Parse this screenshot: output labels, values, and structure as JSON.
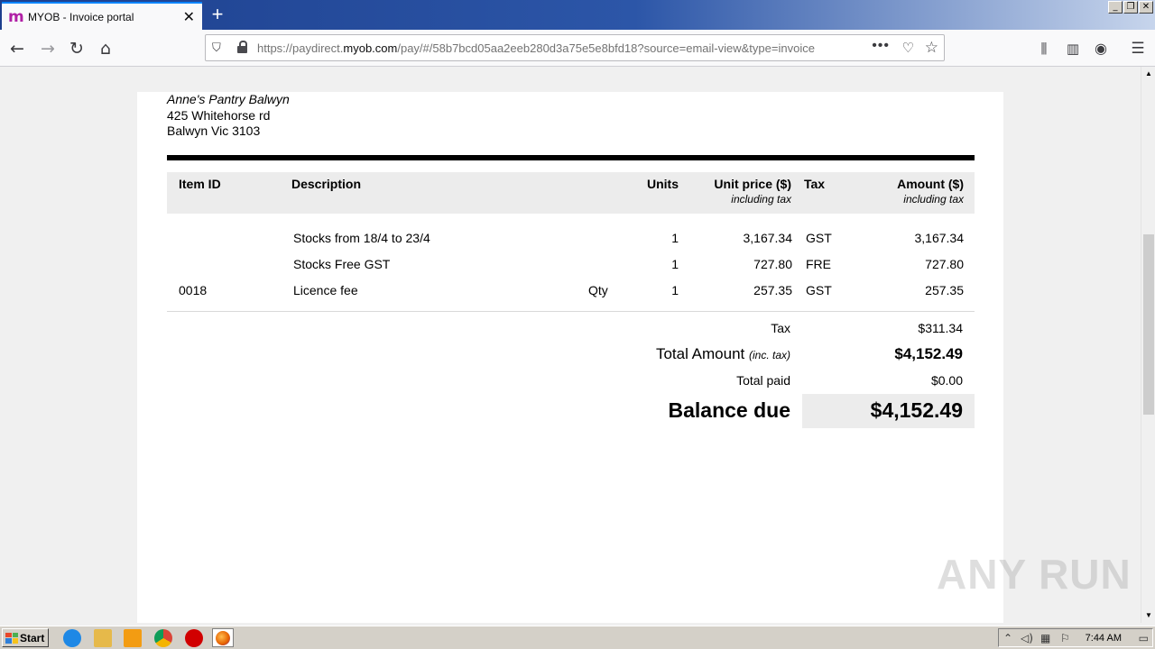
{
  "browser": {
    "tab_title": "MYOB - Invoice portal",
    "url_prefix": "https://paydirect.",
    "url_domain": "myob.com",
    "url_suffix": "/pay/#/58b7bcd05aa2eeb280d3a75e5e8bfd18?source=email-view&type=invoice"
  },
  "customer": {
    "name": "Anne's Pantry Balwyn",
    "address_line1": "425 Whitehorse rd",
    "address_line2": "Balwyn Vic 3103"
  },
  "table": {
    "headers": {
      "item_id": "Item ID",
      "description": "Description",
      "units": "Units",
      "unit_price": "Unit price ($)",
      "unit_price_sub": "including tax",
      "tax": "Tax",
      "amount": "Amount ($)",
      "amount_sub": "including tax"
    },
    "rows": [
      {
        "item_id": "",
        "description": "Stocks from 18/4 to 23/4",
        "unit_label": "",
        "units": "1",
        "unit_price": "3,167.34",
        "tax": "GST",
        "amount": "3,167.34"
      },
      {
        "item_id": "",
        "description": "Stocks Free GST",
        "unit_label": "",
        "units": "1",
        "unit_price": "727.80",
        "tax": "FRE",
        "amount": "727.80"
      },
      {
        "item_id": "0018",
        "description": "Licence fee",
        "unit_label": "Qty",
        "units": "1",
        "unit_price": "257.35",
        "tax": "GST",
        "amount": "257.35"
      }
    ]
  },
  "totals": {
    "tax_label": "Tax",
    "tax_value": "$311.34",
    "total_label": "Total Amount",
    "total_note": "(inc. tax)",
    "total_value": "$4,152.49",
    "paid_label": "Total paid",
    "paid_value": "$0.00",
    "balance_label": "Balance due",
    "balance_value": "$4,152.49"
  },
  "taskbar": {
    "start_label": "Start",
    "clock": "7:44 AM"
  },
  "watermark": "ANY RUN"
}
